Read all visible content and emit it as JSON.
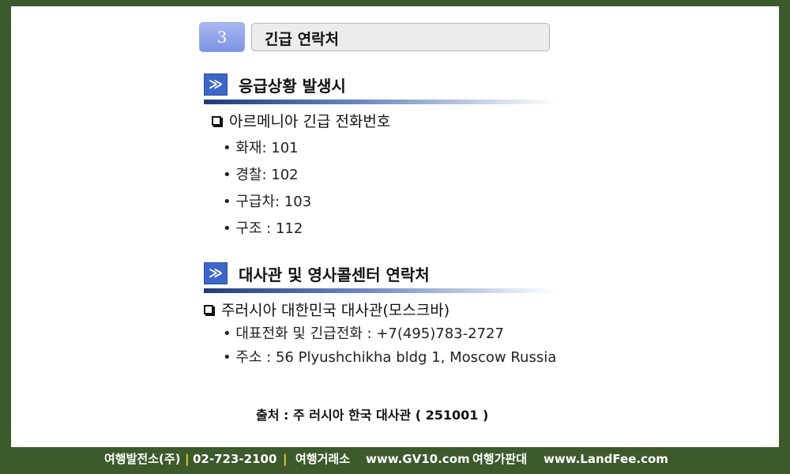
{
  "section_number": "3",
  "section_title": "긴급 연락처",
  "emergency": {
    "heading": "응급상황 발생시",
    "subheading": "아르메니아 긴급 전화번호",
    "items": [
      "화재: 101",
      "경찰: 102",
      "구급차: 103",
      "구조 : 112"
    ]
  },
  "embassy": {
    "heading": "대사관 및 영사콜센터 연락처",
    "subheading": "주러시아 대한민국 대사관(모스크바)",
    "items": [
      "대표전화 및 긴급전화 : +7(495)783-2727",
      "주소 : 56 Plyushchikha bldg 1, Moscow Russia"
    ]
  },
  "source": "출처 : 주 러시아 한국 대사관 ( 251001 )",
  "footer": {
    "company": "여행발전소(주)",
    "phone": "02-723-2100",
    "exchange_label": "여행거래소",
    "exchange_url": "www.GV10.com",
    "price_label": "여행가판대",
    "price_url": "www.LandFee.com",
    "separator": "|"
  },
  "colors": {
    "background": "#3c5a2c",
    "accent": "#3e66c8",
    "separator": "#f2d23a"
  }
}
